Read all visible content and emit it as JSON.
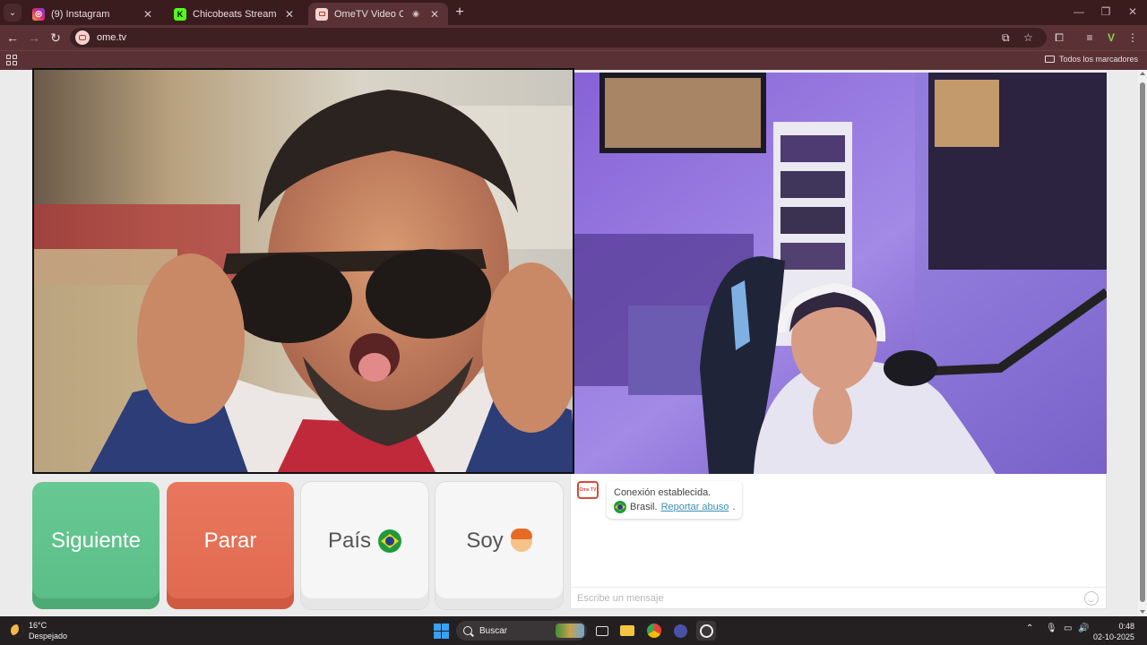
{
  "browser": {
    "tabs": [
      {
        "title": "(9) Instagram",
        "favicon": "instagram-icon",
        "active": false
      },
      {
        "title": "Chicobeats Stream - Watch Live",
        "favicon": "kick-icon",
        "active": false
      },
      {
        "title": "OmeTV Video Chat — OmeTV",
        "favicon": "ometv-icon",
        "active": true
      }
    ],
    "url": "ome.tv",
    "bookmarks_all": "Todos los marcadores"
  },
  "colors": {
    "next": "#5bbd86",
    "stop": "#e0694f",
    "link": "#3b8fb5",
    "chrome": "#5a3236"
  },
  "controls": {
    "next_label": "Siguiente",
    "stop_label": "Parar",
    "country_label": "País",
    "me_label": "Soy"
  },
  "chat": {
    "logo_text": "Ome TV",
    "status": "Conexión establecida.",
    "country": "Brasil.",
    "report_link": "Reportar abuso",
    "report_suffix": ".",
    "input_placeholder": "Escribe un mensaje"
  },
  "taskbar": {
    "weather_temp": "16°C",
    "weather_desc": "Despejado",
    "search_label": "Buscar",
    "time": "0:48",
    "date": "02-10-2025"
  }
}
